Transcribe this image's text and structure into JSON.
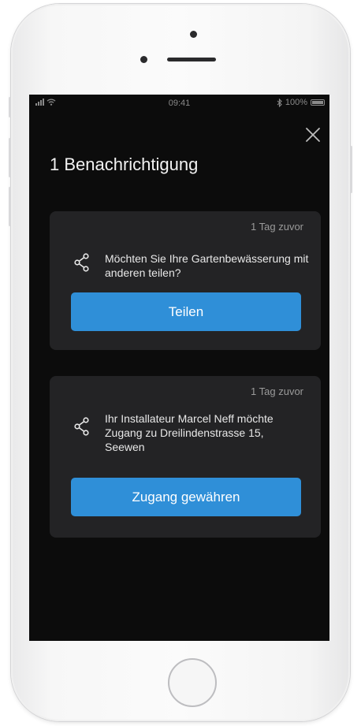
{
  "status_bar": {
    "time": "09:41",
    "battery": "100%",
    "bluetooth_icon": "bluetooth-icon",
    "signal_icon": "signal-icon",
    "wifi_icon": "wifi-icon",
    "battery_icon": "battery-icon"
  },
  "header": {
    "title": "1 Benachrichtigung",
    "close_icon": "close-icon"
  },
  "notifications": [
    {
      "time": "1 Tag zuvor",
      "icon": "share-icon",
      "message": "Möchten Sie Ihre Gartenbewässerung mit anderen teilen?",
      "button_label": "Teilen"
    },
    {
      "time": "1 Tag zuvor",
      "icon": "share-icon",
      "message": "Ihr Installateur Marcel Neff möchte Zugang zu Dreilindenstrasse 15, Seewen",
      "button_label": "Zugang gewähren"
    }
  ],
  "colors": {
    "screen_background": "#0c0c0c",
    "card_background": "#232325",
    "accent": "#2f8fd8",
    "text_primary": "#f2f2f2",
    "text_secondary": "#9a9a9a"
  }
}
